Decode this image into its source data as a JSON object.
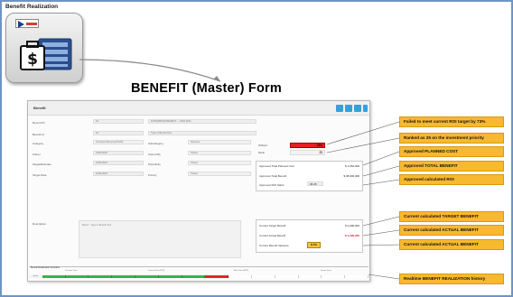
{
  "header": {
    "section_label": "Benefit Realization",
    "form_title": "BENEFIT (Master) Form"
  },
  "form": {
    "title": "Benefit",
    "fields": {
      "record_label": "Record ID",
      "record_value": "42",
      "record_name": "ENTERPRISE BENEFIT — 2020-2021",
      "benefit_label": "Benefit Id",
      "benefit_value": "42",
      "benefit_name": "Type or Benefit Text",
      "category_label": "Category",
      "category_value": "Increased Revenue/Profits",
      "subcategory_label": "Subcategory",
      "subcategory_value": "Revenue",
      "owner_label": "Owner",
      "owner_value": "01/01/2020",
      "owned_by_label": "Owned By",
      "owned_by_value": "Please",
      "target_label": "Target/Estimate",
      "target_value": "01/31/2022",
      "periodicity_label": "Periodicity",
      "periodicity_value": "Please",
      "target_date_label": "Target Date",
      "target_date_value": "01/31/2022",
      "priority_label": "Priority",
      "priority_value": "Please",
      "roi_label": "Whitput",
      "roi_value": "73%",
      "rank_label": "Rank",
      "rank_value": "25",
      "description_label": "Description",
      "description_placeholder": "Macro : Type or Benefit Text"
    },
    "approved": {
      "planned_cost_label": "Approved Total Planned Cost",
      "planned_cost_value": "$ 1,054,000",
      "total_benefit_label": "Approved Total Benefit",
      "total_benefit_value": "$ 38,000,000",
      "roi_label": "Approved ROI Starts",
      "roi_value": "36.05"
    },
    "current": {
      "target_label": "Current Target Benefit",
      "target_value": "$ 3,000,000",
      "actual_label": "Current Actual Benefit",
      "actual_value": "$ 1,290,000",
      "variance_label": "Current Benefit Variance",
      "variance_value": "8.7%"
    },
    "history": {
      "title": "Benefit Realization Schedule",
      "group_previous": "Previous Years",
      "group_current": "Current Years (2021)",
      "group_next": "Next Years (2022)",
      "group_future": "Future Years",
      "row_label": "Actual"
    }
  },
  "callouts": [
    "Failed to meet current ROI target by 73%",
    "Ranked as 25 on the investment priority",
    "Approved PLANNED COST",
    "Approved TOTAL BENEFIT",
    "Approved calculated ROI",
    "Current calculated TARGET BENEFIT",
    "Current calculated ACTUAL  BENEFIT",
    "Current calculated ACTUAL  BENEFIT",
    "Realtime BENEFIT REALIZATION history"
  ],
  "colors": {
    "callout": "#f7b92f",
    "alert_red": "#ea1b24",
    "history_green": "#36b44a",
    "frame_blue": "#6f94c6",
    "toolbar_blue": "#3a9fd8"
  },
  "icons": {
    "app": "money-ledger-icon",
    "logo": "company-logo"
  }
}
